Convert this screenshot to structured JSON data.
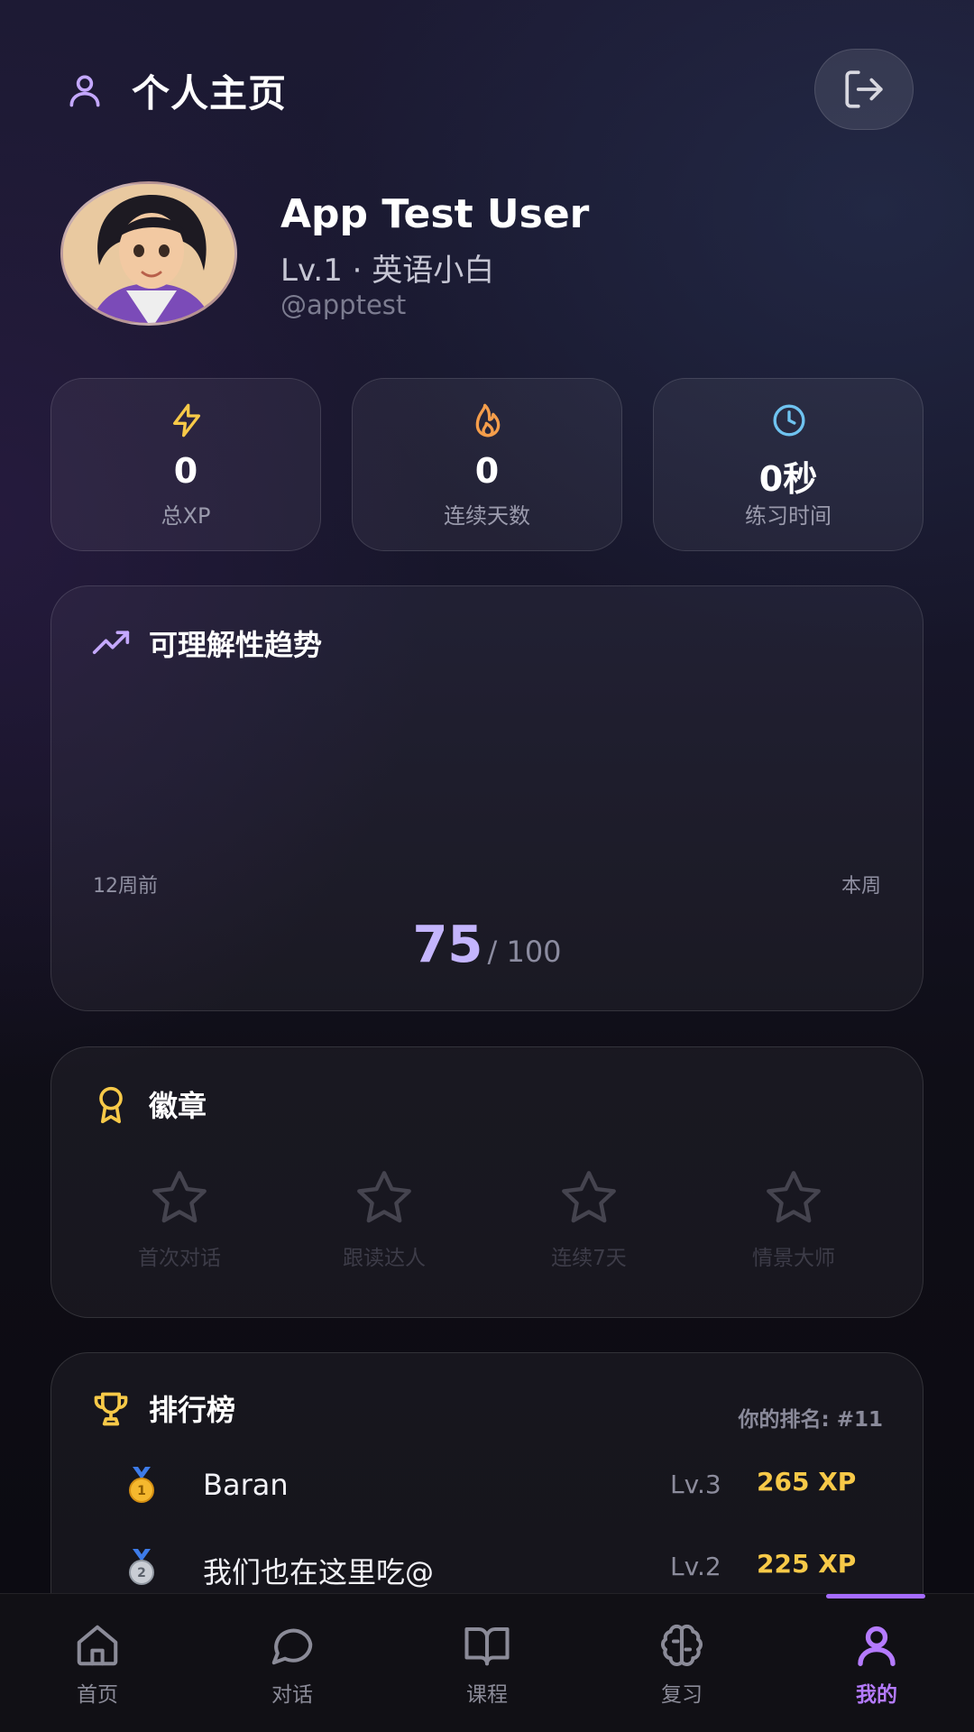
{
  "header": {
    "title": "个人主页"
  },
  "profile": {
    "name": "App Test User",
    "level_text": "Lv.1 · 英语小白",
    "handle": "@apptest"
  },
  "stats": [
    {
      "icon": "lightning-icon",
      "value": "0",
      "label": "总XP",
      "color": "#f7c948"
    },
    {
      "icon": "flame-icon",
      "value": "0",
      "label": "连续天数",
      "color": "#f59e4b"
    },
    {
      "icon": "clock-icon",
      "value": "0秒",
      "label": "练习时间",
      "color": "#6fc3f0"
    }
  ],
  "trend": {
    "title": "可理解性趋势",
    "start_label": "12周前",
    "end_label": "本周",
    "score": "75",
    "score_max": "/ 100",
    "score_color": "#c4b5fd"
  },
  "badges": {
    "title": "徽章",
    "items": [
      {
        "label": "首次对话"
      },
      {
        "label": "跟读达人"
      },
      {
        "label": "连续7天"
      },
      {
        "label": "情景大师"
      }
    ]
  },
  "leaderboard": {
    "title": "排行榜",
    "rank_text": "你的排名: #11",
    "rows": [
      {
        "medal": "gold-medal-icon",
        "name": "Baran",
        "level": "Lv.3",
        "xp": "265 XP"
      },
      {
        "medal": "silver-medal-icon",
        "name": "我们也在这里吃@",
        "level": "Lv.2",
        "xp": "225 XP"
      }
    ]
  },
  "nav": {
    "items": [
      {
        "label": "首页",
        "icon": "home-icon"
      },
      {
        "label": "对话",
        "icon": "chat-icon"
      },
      {
        "label": "课程",
        "icon": "book-icon"
      },
      {
        "label": "复习",
        "icon": "brain-icon"
      },
      {
        "label": "我的",
        "icon": "user-icon",
        "active": true
      }
    ],
    "active_color": "#b57bff"
  }
}
